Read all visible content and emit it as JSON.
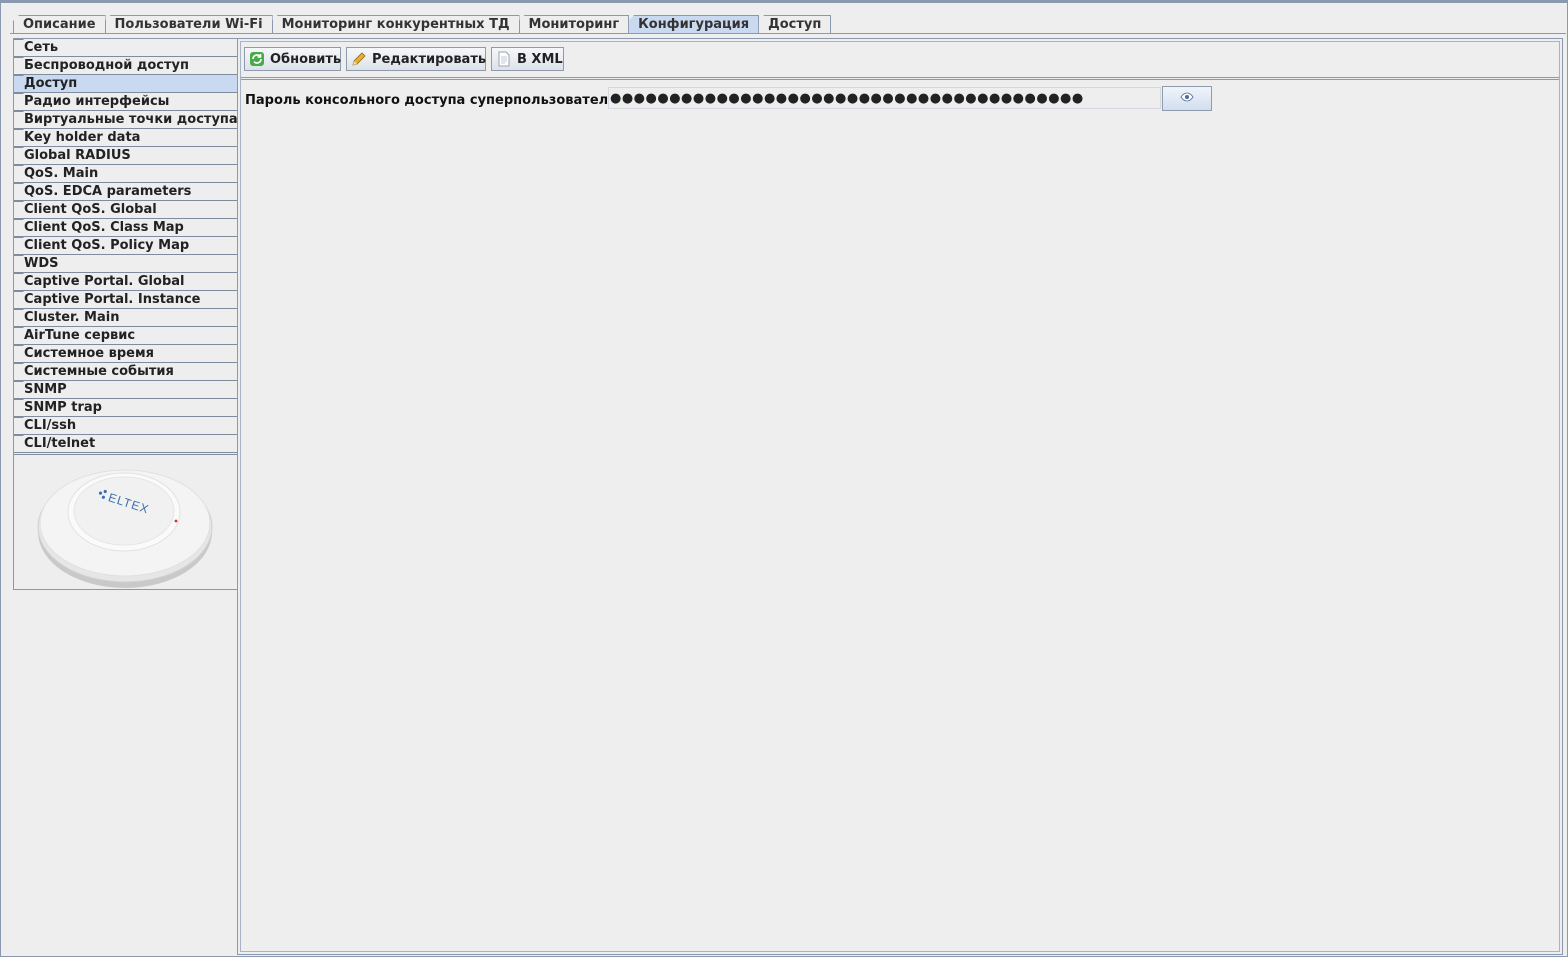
{
  "tabs": [
    {
      "label": "Описание",
      "active": false
    },
    {
      "label": "Пользователи Wi-Fi",
      "active": false
    },
    {
      "label": "Мониторинг конкурентных ТД",
      "active": false
    },
    {
      "label": "Мониторинг",
      "active": false
    },
    {
      "label": "Конфигурация",
      "active": true
    },
    {
      "label": "Доступ",
      "active": false
    }
  ],
  "sidebar": {
    "items": [
      {
        "label": "Сеть",
        "active": false
      },
      {
        "label": "Беспроводной доступ",
        "active": false
      },
      {
        "label": "Доступ",
        "active": true
      },
      {
        "label": "Радио интерфейсы",
        "active": false
      },
      {
        "label": "Виртуальные точки доступа",
        "active": false
      },
      {
        "label": "Key holder data",
        "active": false
      },
      {
        "label": "Global RADIUS",
        "active": false
      },
      {
        "label": "QoS. Main",
        "active": false
      },
      {
        "label": "QoS. EDCA parameters",
        "active": false
      },
      {
        "label": "Client QoS. Global",
        "active": false
      },
      {
        "label": "Client QoS. Class Map",
        "active": false
      },
      {
        "label": "Client QoS. Policy Map",
        "active": false
      },
      {
        "label": "WDS",
        "active": false
      },
      {
        "label": "Captive Portal. Global",
        "active": false
      },
      {
        "label": "Captive Portal. Instance",
        "active": false
      },
      {
        "label": "Cluster. Main",
        "active": false
      },
      {
        "label": "AirTune сервис",
        "active": false
      },
      {
        "label": "Системное время",
        "active": false
      },
      {
        "label": "Системные события",
        "active": false
      },
      {
        "label": "SNMP",
        "active": false
      },
      {
        "label": "SNMP trap",
        "active": false
      },
      {
        "label": "CLI/ssh",
        "active": false
      },
      {
        "label": "CLI/telnet",
        "active": false
      }
    ],
    "device_logo_text": "ELTEX"
  },
  "toolbar": {
    "refresh_label": "Обновить",
    "edit_label": "Редактировать",
    "xml_label": "В XML",
    "refresh_icon": "refresh-icon",
    "edit_icon": "pencil-icon",
    "xml_icon": "document-icon"
  },
  "form": {
    "password_label": "Пароль консольного доступа суперпользователя",
    "password_value": "●●●●●●●●●●●●●●●●●●●●●●●●●●●●●●●●●●●●●●●●",
    "reveal_icon": "eye-icon"
  },
  "colors": {
    "accent_active": "#c9daf0",
    "border": "#8a99b0",
    "background": "#eeeeee"
  }
}
